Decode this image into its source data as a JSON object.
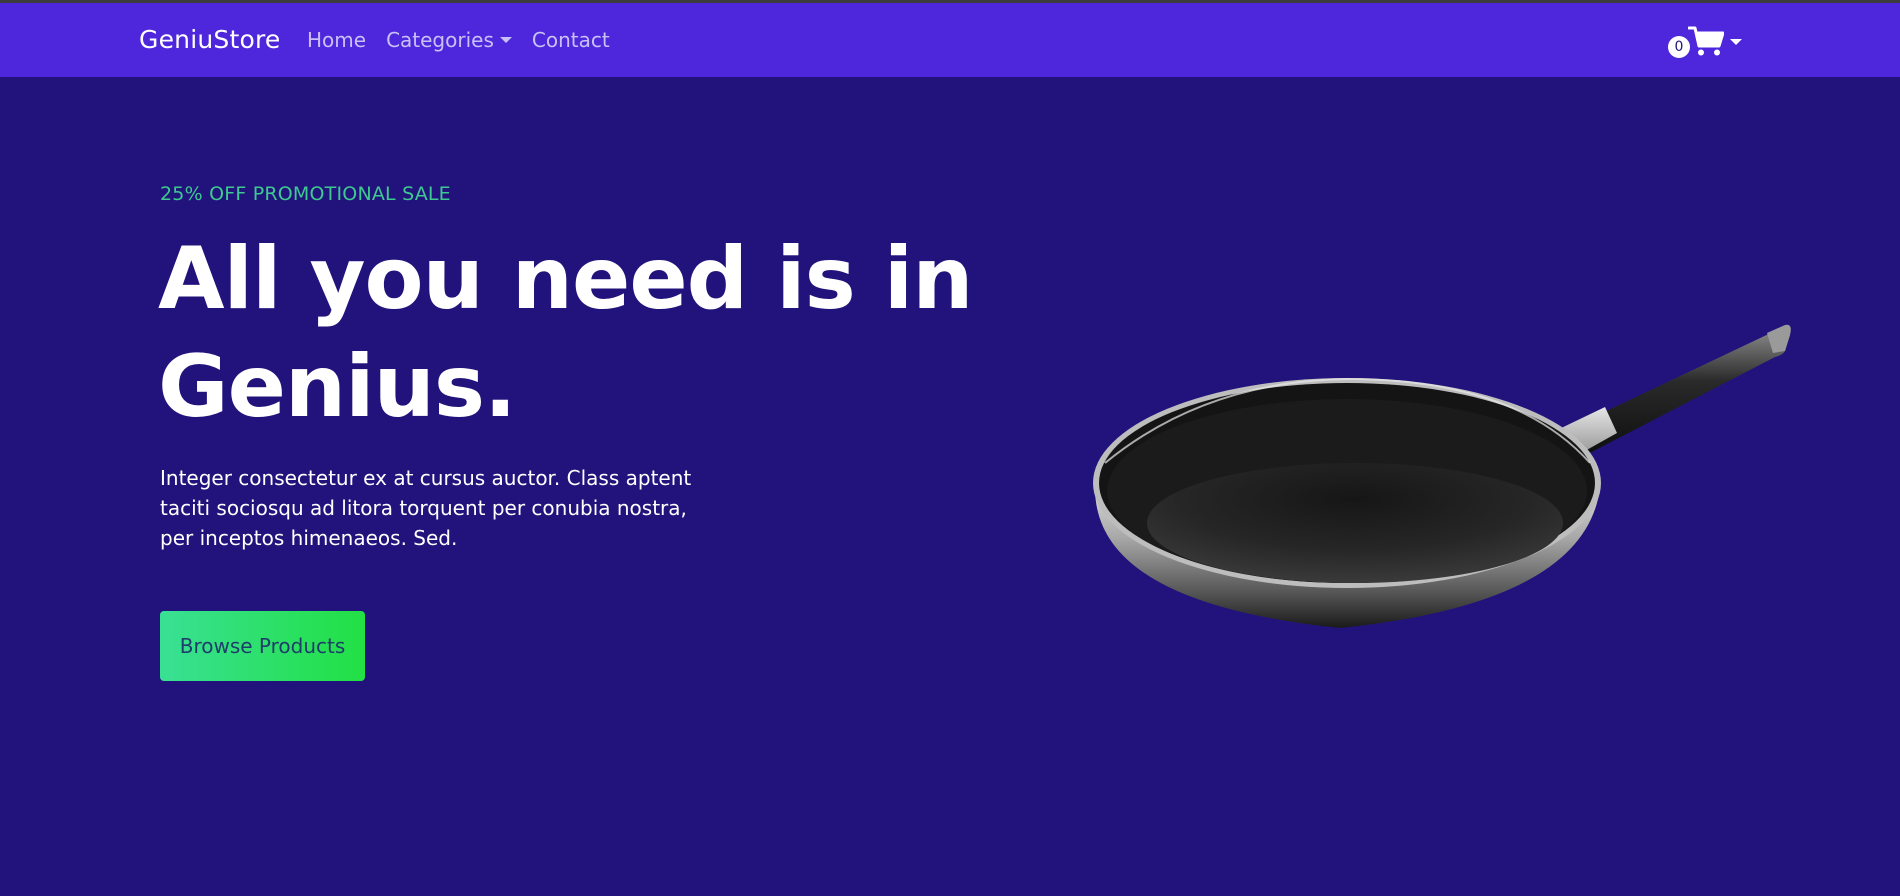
{
  "navbar": {
    "brand": "GeniuStore",
    "links": [
      {
        "label": "Home"
      },
      {
        "label": "Categories",
        "has_dropdown": true
      },
      {
        "label": "Contact"
      }
    ],
    "cart": {
      "count": "0",
      "icon": "shopping-cart-icon"
    }
  },
  "hero": {
    "promo": "25% OFF PROMOTIONAL SALE",
    "headline": "All you need is in Genius.",
    "description": "Integer consectetur ex at cursus auctor. Class aptent taciti sociosqu ad litora torquent per conubia nostra, per inceptos himenaeos. Sed.",
    "cta_label": "Browse Products",
    "image": "frying-pan"
  },
  "colors": {
    "navbar_bg": "#4e27dd",
    "page_bg": "#22137c",
    "promo": "#3ec990",
    "cta_gradient_start": "#39e094",
    "cta_gradient_end": "#22e044",
    "cta_text": "#1f3d6b"
  }
}
